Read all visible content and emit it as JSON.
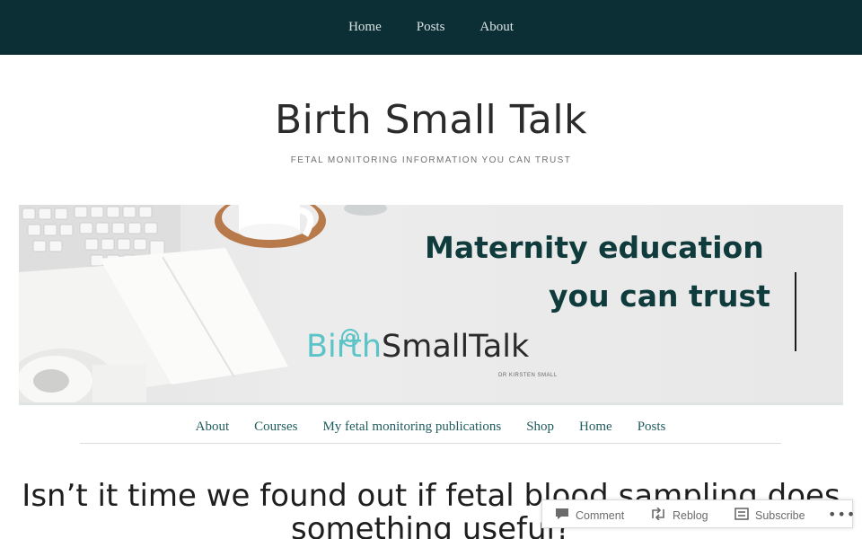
{
  "top_nav": {
    "items": [
      "Home",
      "Posts",
      "About"
    ]
  },
  "site": {
    "title": "Birth Small Talk",
    "tagline": "FETAL MONITORING INFORMATION YOU CAN TRUST"
  },
  "banner": {
    "line1": "Maternity education",
    "line2": "you can trust",
    "logo_part1": "Birth",
    "logo_part2": "SmallTalk",
    "logo_sub": "DR KIRSTEN SMALL"
  },
  "main_nav": {
    "items": [
      "About",
      "Courses",
      "My fetal monitoring publications",
      "Shop",
      "Home",
      "Posts"
    ]
  },
  "post": {
    "title": "Isn’t it time we found out if fetal blood sampling does something useful?"
  },
  "action_bar": {
    "comment": "Comment",
    "reblog": "Reblog",
    "subscribe": "Subscribe",
    "more": "•••"
  },
  "colors": {
    "topbar_bg": "#0c2f35",
    "link_teal": "#1f5c5e",
    "logo_teal": "#5cc3c6"
  }
}
